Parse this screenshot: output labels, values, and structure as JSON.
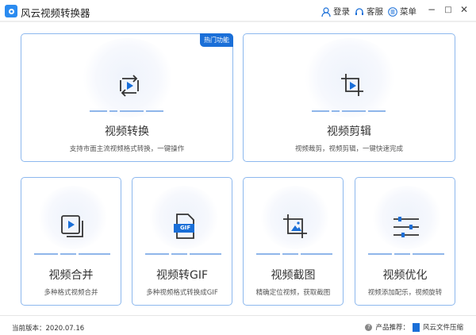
{
  "app": {
    "title": "风云视频转换器"
  },
  "header": {
    "login": "登录",
    "service": "客服",
    "menu": "菜单",
    "minimize": "−",
    "maximize": "□",
    "close": "✕"
  },
  "cards": [
    {
      "title": "视频转换",
      "desc": "支持市面主流视频格式转换，一键操作",
      "badge": "热门功能",
      "icon": "convert-play-icon"
    },
    {
      "title": "视频剪辑",
      "desc": "视频裁剪，视频剪辑，一键快速完成",
      "icon": "crop-icon"
    },
    {
      "title": "视频合并",
      "desc": "多种格式视频合并",
      "icon": "merge-icon"
    },
    {
      "title": "视频转GIF",
      "desc": "多种视频格式转换成GIF",
      "icon": "gif-file-icon",
      "icon_text": "GIF"
    },
    {
      "title": "视频截图",
      "desc": "精确定位视频，获取截图",
      "icon": "screenshot-icon"
    },
    {
      "title": "视频优化",
      "desc": "视频添加配乐，视频旋转",
      "icon": "sliders-icon"
    }
  ],
  "footer": {
    "version": "当前版本：2020.07.16",
    "recommend": "产品推荐：",
    "product": "风云文件压缩"
  },
  "colors": {
    "accent": "#1a6fd8",
    "border": "#8db8ee"
  }
}
